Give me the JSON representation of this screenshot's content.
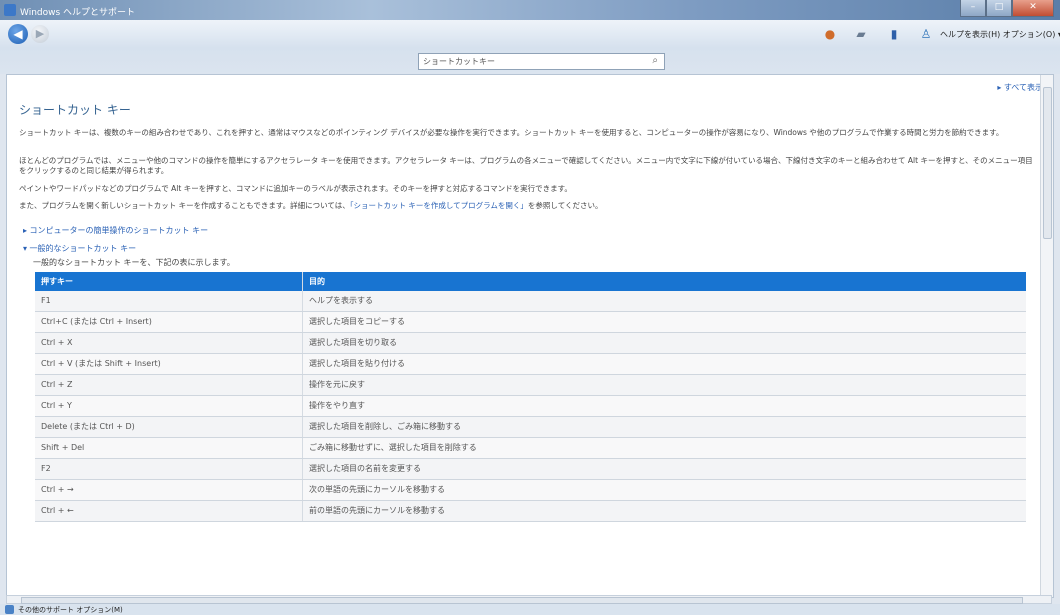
{
  "window": {
    "title": "Windows ヘルプとサポート"
  },
  "navbar": {
    "back_label": "◀",
    "forward_label": "▶",
    "top_text": "ヘルプを表示(H)  オプション(O) ▾"
  },
  "search": {
    "value": "ショートカットキー"
  },
  "content": {
    "show_all": "▸ すべて表示",
    "title": "ショートカット キー",
    "para1": "ショートカット キーは、複数のキーの組み合わせであり、これを押すと、通常はマウスなどのポインティング デバイスが必要な操作を実行できます。ショートカット キーを使用すると、コンピューターの操作が容易になり、Windows や他のプログラムで作業する時間と労力を節約できます。",
    "para2": "ほとんどのプログラムでは、メニューや他のコマンドの操作を簡単にするアクセラレータ キーを使用できます。アクセラレータ キーは、プログラムの各メニューで確認してください。メニュー内で文字に下線が付いている場合、下線付き文字のキーと組み合わせて Alt キーを押すと、そのメニュー項目をクリックするのと同じ結果が得られます。",
    "para3": "ペイントやワードパッドなどのプログラムで Alt キーを押すと、コマンドに追加キーのラベルが表示されます。そのキーを押すと対応するコマンドを実行できます。",
    "para4_prefix": "また、プログラムを開く新しいショートカット キーを作成することもできます。詳細については、",
    "para4_link": "「ショートカット キーを作成してプログラムを開く」",
    "para4_suffix": "を参照してください。",
    "section1": "▸ コンピューターの簡単操作のショートカット キー",
    "section2": "▾ 一般的なショートカット キー",
    "section2_desc": "一般的なショートカット キーを、下記の表に示します。"
  },
  "table": {
    "headers": [
      "押すキー",
      "目的"
    ],
    "rows": [
      [
        "F1",
        "ヘルプを表示する"
      ],
      [
        "Ctrl+C (または Ctrl + Insert)",
        "選択した項目をコピーする"
      ],
      [
        "Ctrl + X",
        "選択した項目を切り取る"
      ],
      [
        "Ctrl + V (または Shift + Insert)",
        "選択した項目を貼り付ける"
      ],
      [
        "Ctrl + Z",
        "操作を元に戻す"
      ],
      [
        "Ctrl + Y",
        "操作をやり直す"
      ],
      [
        "Delete (または Ctrl + D)",
        "選択した項目を削除し、ごみ箱に移動する"
      ],
      [
        "Shift + Del",
        "ごみ箱に移動せずに、選択した項目を削除する"
      ],
      [
        "F2",
        "選択した項目の名前を変更する"
      ],
      [
        "Ctrl + →",
        "次の単語の先頭にカーソルを移動する"
      ],
      [
        "Ctrl + ←",
        "前の単語の先頭にカーソルを移動する"
      ]
    ]
  },
  "status": {
    "text": "その他のサポート オプション(M)"
  }
}
